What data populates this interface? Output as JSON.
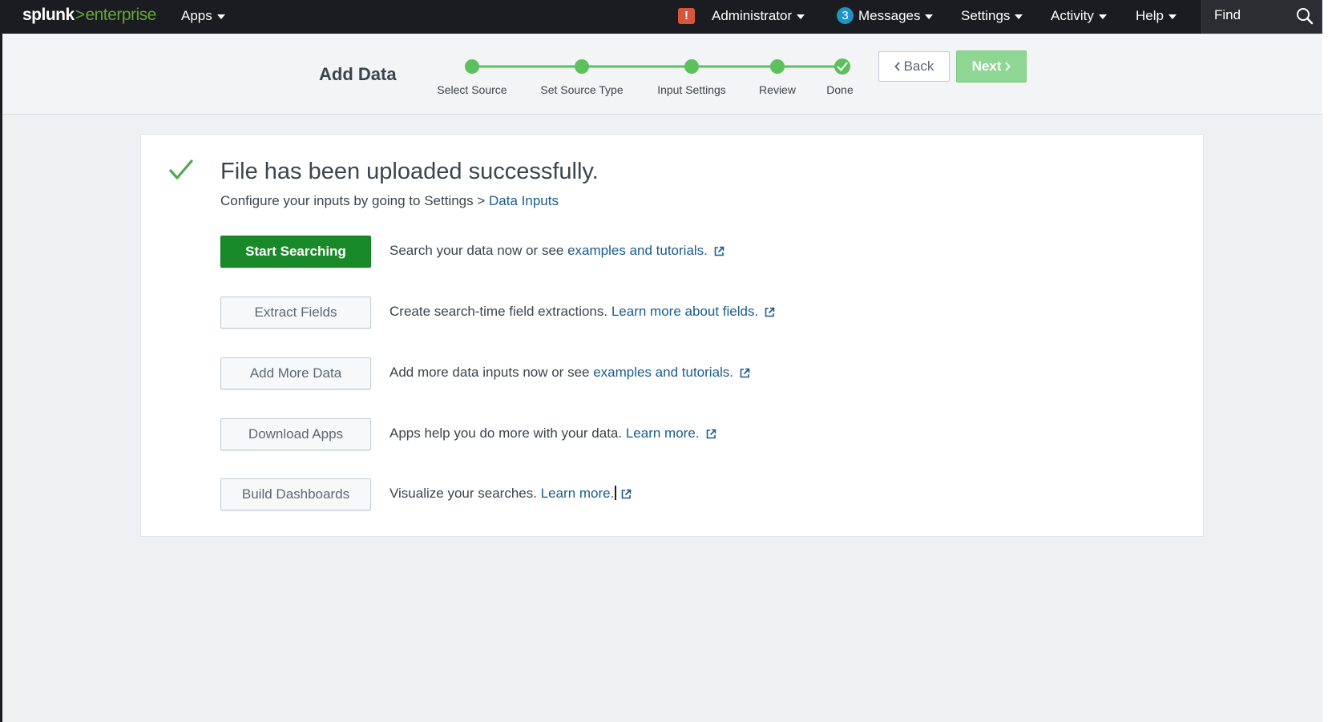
{
  "topbar": {
    "brand_main": "splunk",
    "brand_chevron": ">",
    "brand_product": "enterprise",
    "apps_label": "Apps",
    "alert_glyph": "!",
    "admin_label": "Administrator",
    "messages_count": "3",
    "messages_label": "Messages",
    "settings_label": "Settings",
    "activity_label": "Activity",
    "help_label": "Help",
    "find_label": "Find"
  },
  "wizard": {
    "title": "Add Data",
    "steps": [
      {
        "label": "Select Source",
        "state": "complete"
      },
      {
        "label": "Set Source Type",
        "state": "complete"
      },
      {
        "label": "Input Settings",
        "state": "complete"
      },
      {
        "label": "Review",
        "state": "complete"
      },
      {
        "label": "Done",
        "state": "current-done"
      }
    ],
    "back_label": "Back",
    "next_label": "Next"
  },
  "result": {
    "title": "File has been uploaded successfully.",
    "subtitle_prefix": "Configure your inputs by going to Settings > ",
    "subtitle_link": "Data Inputs"
  },
  "actions": [
    {
      "button": "Start Searching",
      "desc": "Search your data now or see ",
      "link": "examples and tutorials."
    },
    {
      "button": "Extract Fields",
      "desc": "Create search-time field extractions. ",
      "link": "Learn more about fields."
    },
    {
      "button": "Add More Data",
      "desc": "Add more data inputs now or see ",
      "link": "examples and tutorials."
    },
    {
      "button": "Download Apps",
      "desc": "Apps help you do more with your data. ",
      "link": "Learn more."
    },
    {
      "button": "Build Dashboards",
      "desc": "Visualize your searches. ",
      "link": "Learn more."
    }
  ],
  "colors": {
    "topbar_bg": "#1a1c21",
    "brand_green": "#65a637",
    "step_green": "#5cc05c",
    "primary_button": "#1a8929",
    "link_blue": "#1a5b8e",
    "alert_red": "#d6563c",
    "message_blue": "#1e93c6"
  },
  "icons": [
    "caret-down-icon",
    "alert-icon",
    "search-icon",
    "checkmark-icon",
    "external-link-icon",
    "chevron-left-icon",
    "chevron-right-icon"
  ]
}
